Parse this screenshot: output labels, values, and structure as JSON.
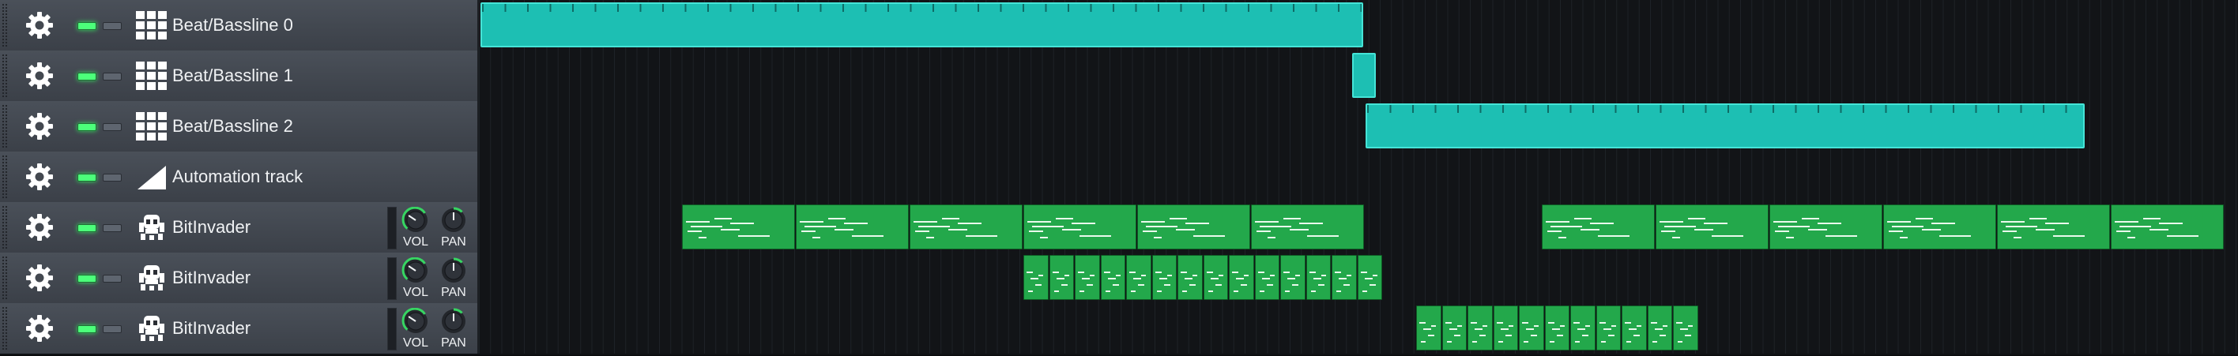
{
  "colors": {
    "led_on": "#4cff7a",
    "bb_clip": "#1dbfb3",
    "pattern_clip": "#23a84b",
    "knob_accent": "#37d562"
  },
  "tracks": [
    {
      "name": "Beat/Bassline 0",
      "icon": "grid-icon",
      "kind": "bb"
    },
    {
      "name": "Beat/Bassline 1",
      "icon": "grid-icon",
      "kind": "bb"
    },
    {
      "name": "Beat/Bassline 2",
      "icon": "grid-icon",
      "kind": "bb"
    },
    {
      "name": "Automation track",
      "icon": "automation-ramp-icon",
      "kind": "automation"
    },
    {
      "name": "BitInvader",
      "icon": "bitinvader-icon",
      "kind": "instrument",
      "vol_label": "VOL",
      "pan_label": "PAN"
    },
    {
      "name": "BitInvader",
      "icon": "bitinvader-icon",
      "kind": "instrument",
      "vol_label": "VOL",
      "pan_label": "PAN"
    },
    {
      "name": "BitInvader",
      "icon": "bitinvader-icon",
      "kind": "instrument",
      "vol_label": "VOL",
      "pan_label": "PAN"
    }
  ]
}
